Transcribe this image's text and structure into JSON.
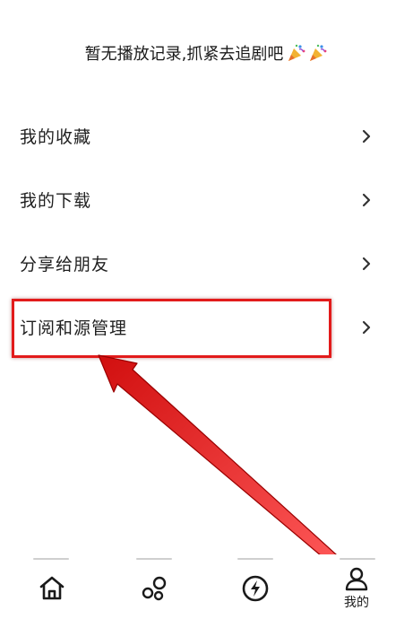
{
  "history": {
    "empty_text": "暂无播放记录,抓紧去追剧吧",
    "decoration_icon": "party-popper-icon"
  },
  "menu": {
    "items": [
      {
        "label": "我的收藏",
        "icon": "chevron-right-icon"
      },
      {
        "label": "我的下载",
        "icon": "chevron-right-icon"
      },
      {
        "label": "分享给朋友",
        "icon": "chevron-right-icon"
      },
      {
        "label": "订阅和源管理",
        "icon": "chevron-right-icon"
      }
    ]
  },
  "annotation": {
    "highlight_color": "#e21b1b",
    "highlighted_item": "订阅和源管理"
  },
  "tab_bar": {
    "tabs": [
      {
        "icon": "home-icon",
        "label": ""
      },
      {
        "icon": "bubbles-icon",
        "label": ""
      },
      {
        "icon": "lightning-icon",
        "label": ""
      },
      {
        "icon": "user-icon",
        "label": "我的",
        "active": true
      }
    ]
  }
}
